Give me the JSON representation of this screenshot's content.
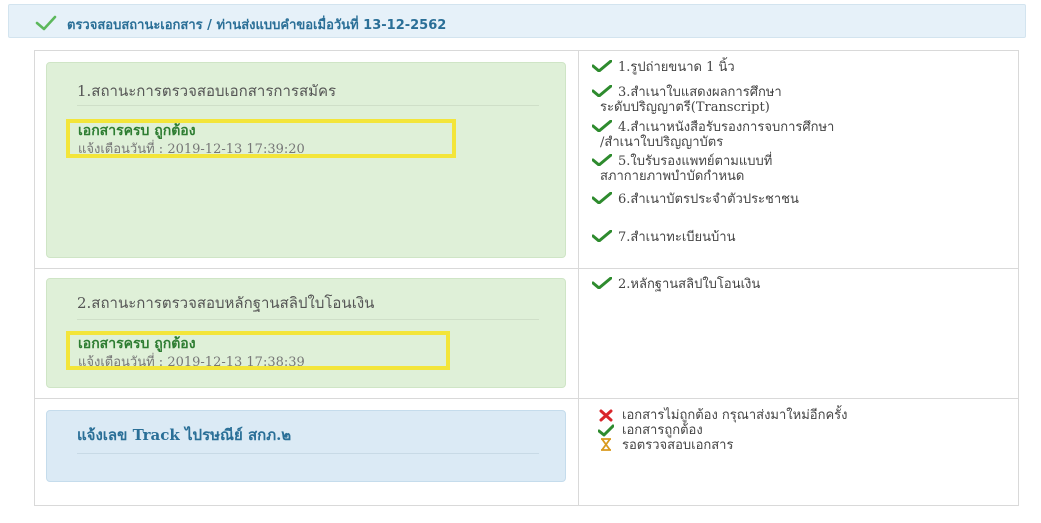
{
  "header": {
    "title": "ตรวจสอบสถานะเอกสาร / ท่านส่งแบบคำขอเมื่อวันที่ 13-12-2562"
  },
  "sections": [
    {
      "title": "1.สถานะการตรวจสอบเอกสารการสมัคร",
      "status": "เอกสารครบ ถูกต้อง",
      "notice": "แจ้งเตือนวันที่ : 2019-12-13 17:39:20",
      "items": [
        [
          "1.รูปถ่ายขนาด 1 นิ้ว"
        ],
        [
          "3.สำเนาใบแสดงผลการศึกษา",
          "ระดับปริญญาตรี(Transcript)"
        ],
        [
          "4.สำเนาหนังสือรับรองการจบการศึกษา",
          "/สำเนาใบปริญญาบัตร"
        ],
        [
          "5.ใบรับรองแพทย์ตามแบบที่",
          "สภากายภาพบำบัดกำหนด"
        ],
        [
          "6.สำเนาบัตรประจำตัวประชาชน"
        ],
        [
          "7.สำเนาทะเบียนบ้าน"
        ]
      ]
    },
    {
      "title": "2.สถานะการตรวจสอบหลักฐานสลิปใบโอนเงิน",
      "status": "เอกสารครบ ถูกต้อง",
      "notice": "แจ้งเตือนวันที่ : 2019-12-13 17:38:39",
      "items": [
        [
          "2.หลักฐานสลิปใบโอนเงิน"
        ]
      ]
    }
  ],
  "track": {
    "title": "แจ้งเลข Track ไปรษณีย์ สกภ.๒"
  },
  "legend": [
    {
      "icon": "cross-icon",
      "label": "เอกสารไม่ถูกต้อง กรุณาส่งมาใหม่อีกครั้ง",
      "color": "#d9262b"
    },
    {
      "icon": "check-icon",
      "label": "เอกสารถูกต้อง",
      "color": "#2e8b2e"
    },
    {
      "icon": "hourglass-icon",
      "label": "รอตรวจสอบเอกสาร",
      "color": "#d99a1e"
    }
  ],
  "colors": {
    "check": "#2e8b2e",
    "header_title": "#2a6f97",
    "highlight": "#f3e53a",
    "success_card": "#dff0d8",
    "info_card": "#dbeaf5"
  }
}
